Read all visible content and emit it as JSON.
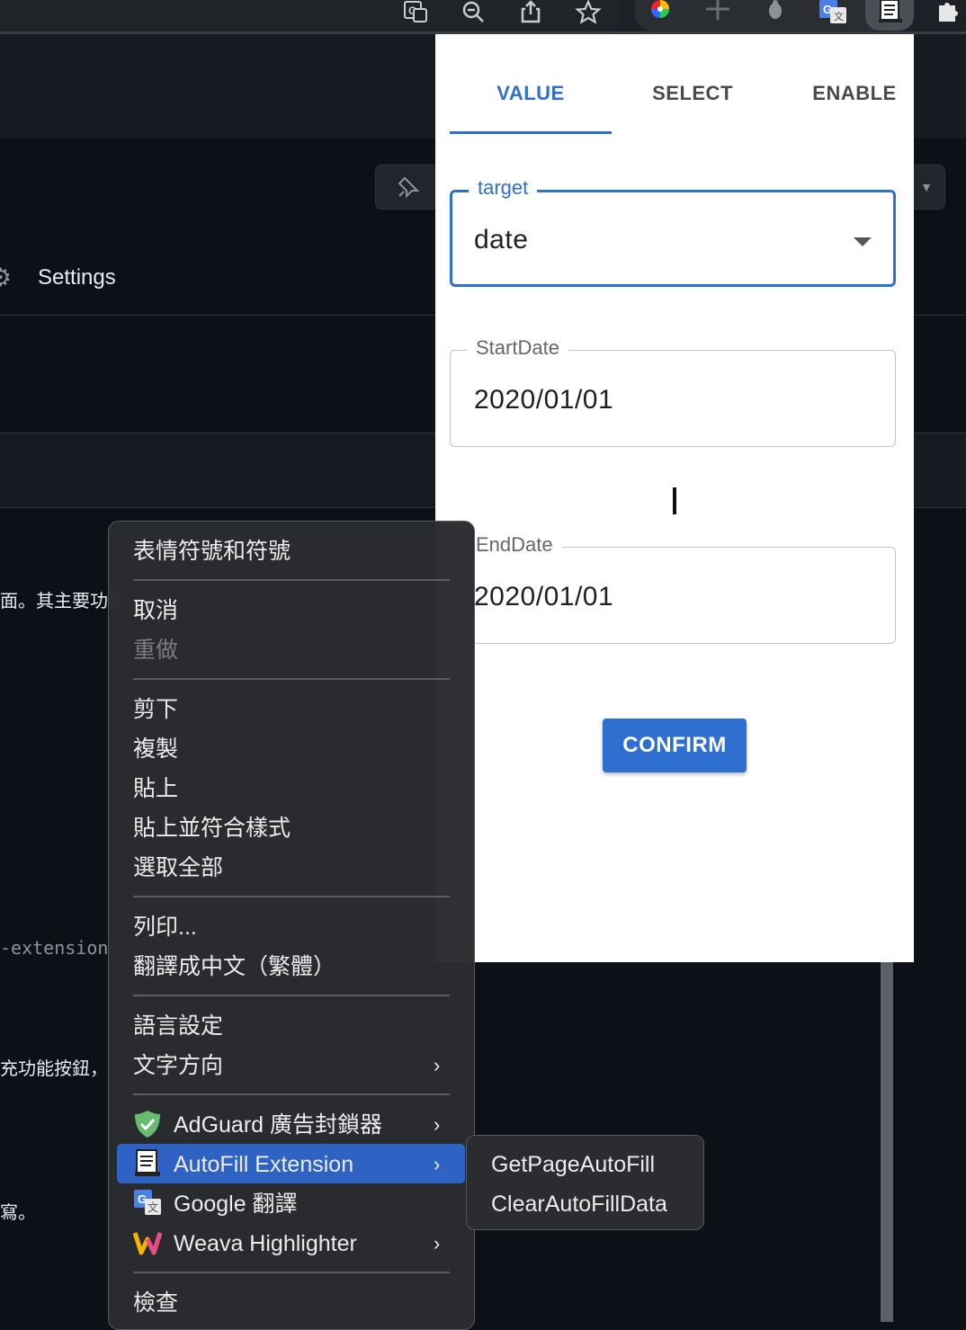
{
  "browser": {
    "toolbar_icons": [
      "translate-page-icon",
      "zoom-out-icon",
      "share-icon",
      "bookmark-star-icon"
    ],
    "extension_icons": [
      "color-picker-icon",
      "measure-icon",
      "bug-icon",
      "google-translate-icon",
      "autofill-extension-icon",
      "puzzle-icon"
    ]
  },
  "page": {
    "settings_label": "Settings",
    "text_fragment_1": "面。其主要功能",
    "text_fragment_2": "-extension",
    "text_fragment_3": "充功能按鈕，",
    "text_fragment_4": "寫。"
  },
  "popup": {
    "tabs": [
      {
        "label": "VALUE",
        "active": true
      },
      {
        "label": "SELECT",
        "active": false
      },
      {
        "label": "ENABLE",
        "active": false
      }
    ],
    "target": {
      "label": "target",
      "value": "date"
    },
    "start_date": {
      "label": "StartDate",
      "value": "2020/01/01"
    },
    "end_date": {
      "label": "EndDate",
      "value": "2020/01/01"
    },
    "confirm_label": "CONFIRM",
    "accent_color": "#2f6fd0"
  },
  "context_menu": {
    "items": [
      {
        "label": "表情符號和符號"
      },
      {
        "label": "取消"
      },
      {
        "label": "重做",
        "disabled": true
      },
      {
        "label": "剪下"
      },
      {
        "label": "複製"
      },
      {
        "label": "貼上"
      },
      {
        "label": "貼上並符合樣式"
      },
      {
        "label": "選取全部"
      },
      {
        "label": "列印..."
      },
      {
        "label": "翻譯成中文（繁體）"
      },
      {
        "label": "語言設定"
      },
      {
        "label": "文字方向",
        "submenu": true
      },
      {
        "label": "AdGuard 廣告封鎖器",
        "icon": "adguard-shield-icon",
        "submenu": true
      },
      {
        "label": "AutoFill Extension",
        "icon": "autofill-extension-icon",
        "submenu": true,
        "highlighted": true
      },
      {
        "label": "Google 翻譯",
        "icon": "google-translate-icon"
      },
      {
        "label": "Weava Highlighter",
        "icon": "weava-icon",
        "submenu": true
      },
      {
        "label": "檢查"
      }
    ],
    "highlight_color": "#2e63c4"
  },
  "submenu": {
    "items": [
      {
        "label": "GetPageAutoFill"
      },
      {
        "label": "ClearAutoFillData"
      }
    ]
  }
}
